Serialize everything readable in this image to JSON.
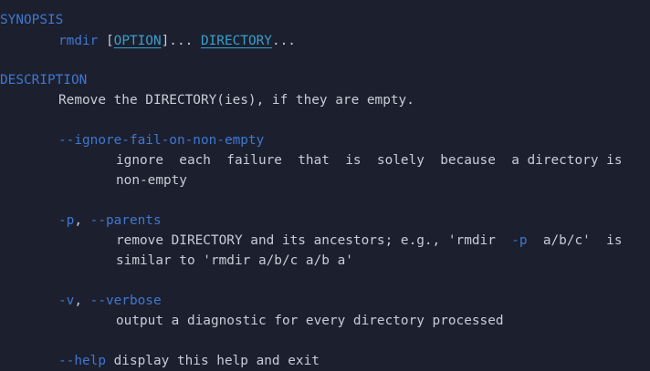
{
  "synopsis": {
    "header": "SYNOPSIS",
    "cmd": "rmdir",
    "open_bracket": " [",
    "option": "OPTION",
    "after_option": "]... ",
    "directory": "DIRECTORY",
    "ellipsis": "..."
  },
  "description": {
    "header": "DESCRIPTION",
    "text": "Remove the DIRECTORY(ies), if they are empty."
  },
  "options": [
    {
      "flags": [
        {
          "text": "--ignore-fail-on-non-empty"
        }
      ],
      "desc_lines": [
        "ignore  each  failure  that  is  solely  because  a directory is",
        "non-empty"
      ]
    },
    {
      "flags": [
        {
          "text": "-p"
        },
        {
          "sep": ", "
        },
        {
          "text": "--parents"
        }
      ],
      "desc_line1_pre": "remove DIRECTORY and its ancestors; e.g., 'rmdir  ",
      "desc_line1_flag": "-p",
      "desc_line1_post": "  a/b/c'  is",
      "desc_line2": "similar to 'rmdir a/b/c a/b a'"
    },
    {
      "flags": [
        {
          "text": "-v"
        },
        {
          "sep": ", "
        },
        {
          "text": "--verbose"
        }
      ],
      "desc_lines": [
        "output a diagnostic for every directory processed"
      ]
    },
    {
      "flag": "--help",
      "desc": " display this help and exit"
    }
  ],
  "colors": {
    "background": "#1c1f2e",
    "text": "#c9ccd6",
    "header": "#3f78d0",
    "link": "#3a9fc9"
  }
}
